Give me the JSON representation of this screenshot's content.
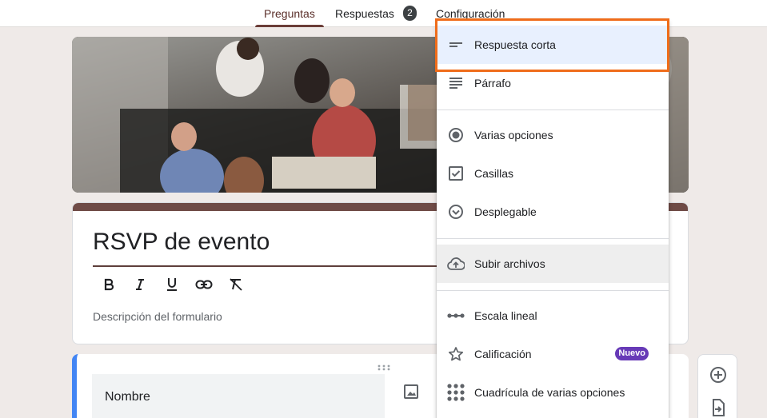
{
  "tabs": [
    {
      "label": "Preguntas",
      "active": true
    },
    {
      "label": "Respuestas",
      "badge": "2"
    },
    {
      "label": "Configuración"
    }
  ],
  "form": {
    "title": "RSVP de evento",
    "description_placeholder": "Descripción del formulario",
    "format_tools": [
      "bold-icon",
      "italic-icon",
      "underline-icon",
      "link-icon",
      "clear-format-icon"
    ]
  },
  "question": {
    "title": "Nombre"
  },
  "menu": {
    "items": [
      {
        "label": "Respuesta corta",
        "icon": "short-answer-icon",
        "selected": true
      },
      {
        "label": "Párrafo",
        "icon": "paragraph-icon"
      },
      {
        "label": "Varias opciones",
        "icon": "radio-icon"
      },
      {
        "label": "Casillas",
        "icon": "checkbox-icon"
      },
      {
        "label": "Desplegable",
        "icon": "dropdown-icon"
      },
      {
        "label": "Subir archivos",
        "icon": "upload-icon",
        "hovered": true
      },
      {
        "label": "Escala lineal",
        "icon": "linear-scale-icon"
      },
      {
        "label": "Calificación",
        "icon": "star-icon",
        "badge": "Nuevo"
      },
      {
        "label": "Cuadrícula de varias opciones",
        "icon": "grid-icon"
      }
    ]
  },
  "colors": {
    "accent": "#6b3d38",
    "question_accent": "#4285f4",
    "highlight": "#ef6c1a",
    "new_badge": "#673ab7"
  }
}
